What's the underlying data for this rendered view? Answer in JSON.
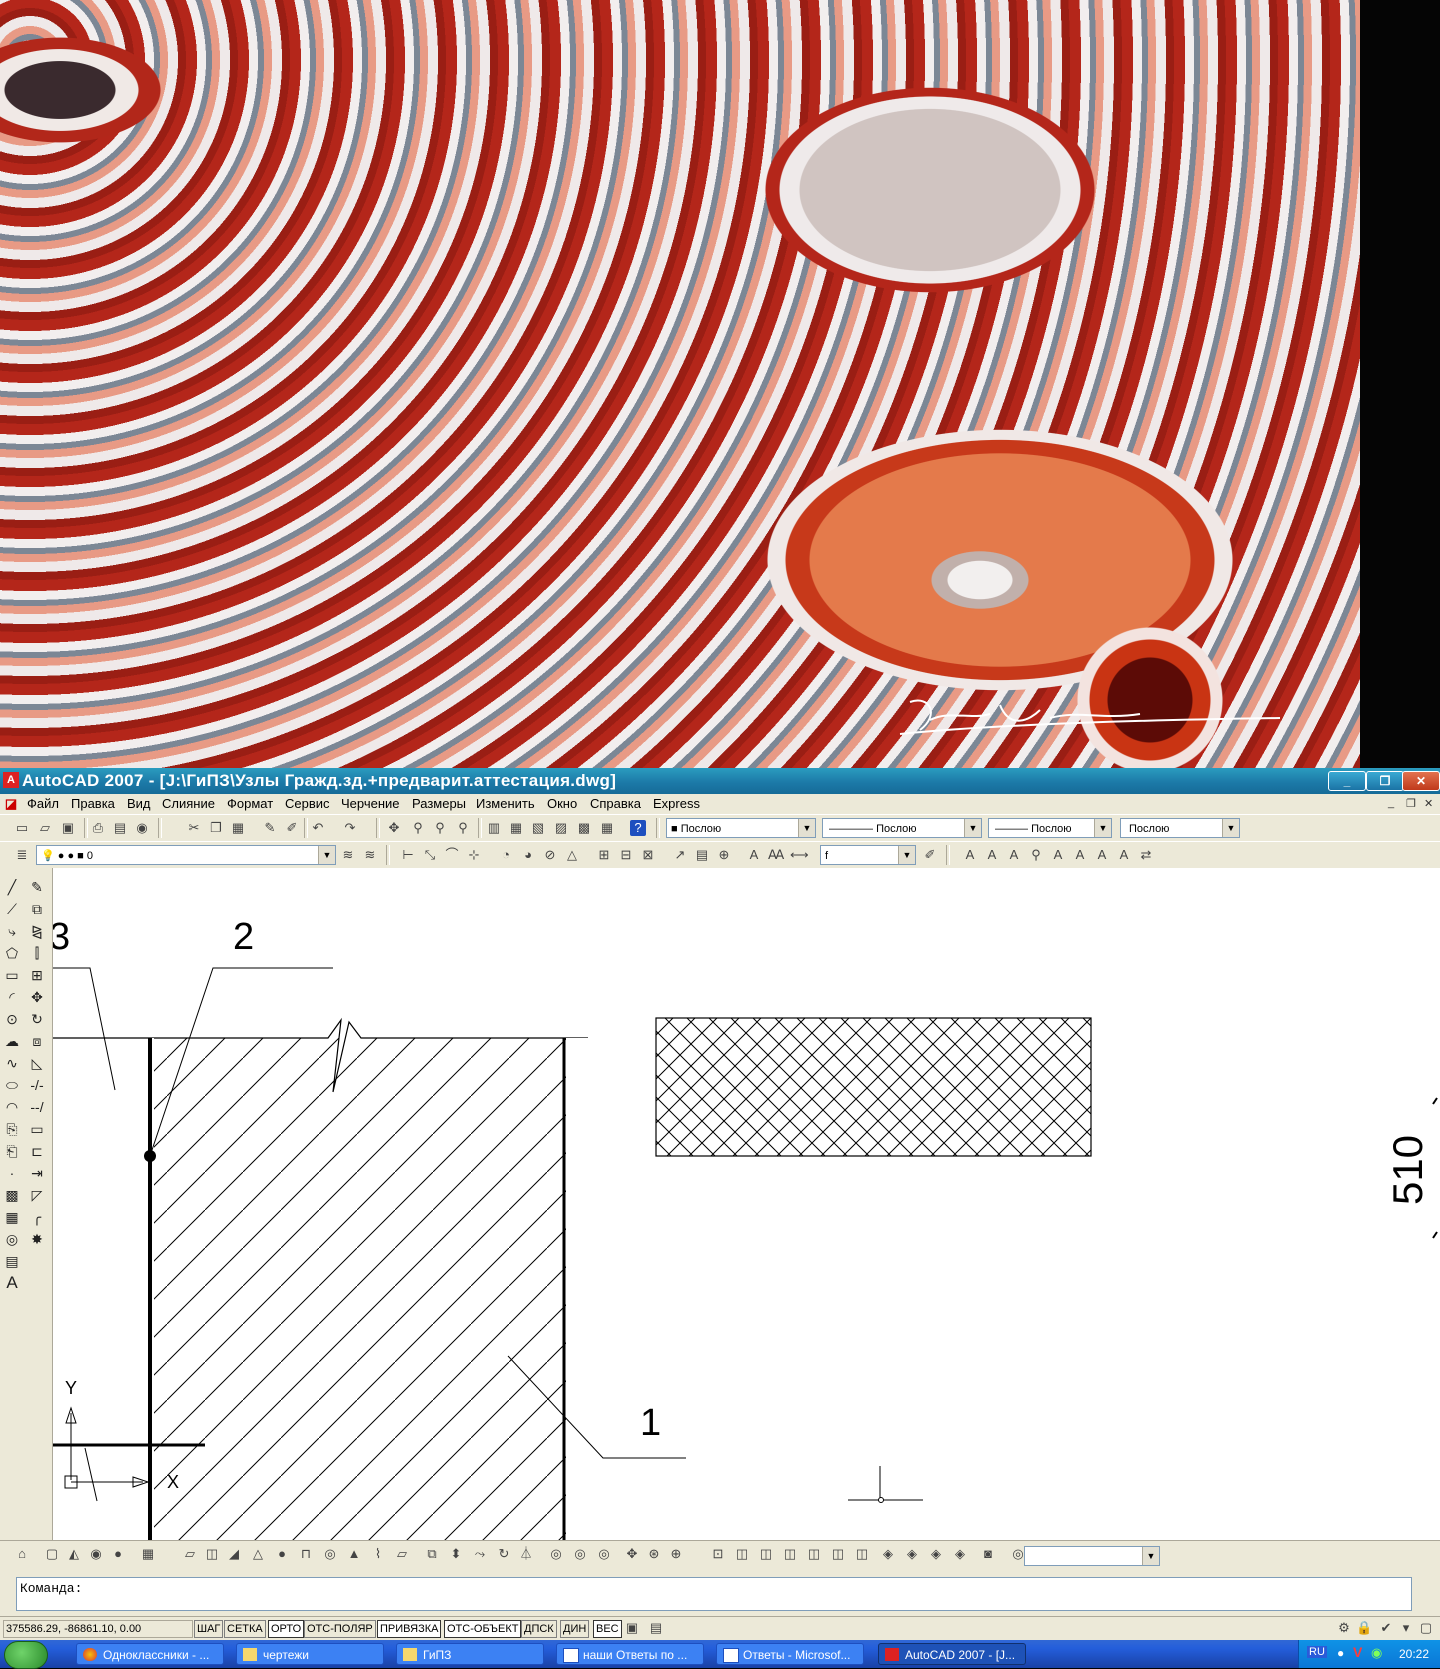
{
  "window": {
    "title": "AutoCAD 2007 - [J:\\ГиПЗ\\Узлы Гражд.зд.+предварит.аттестация.dwg]",
    "app_icon_text": "A",
    "controls": {
      "minimize": "_",
      "restore": "❐",
      "close": "✕"
    },
    "mdi_controls": {
      "minimize": "_",
      "restore": "❐",
      "close": "✕"
    }
  },
  "menu": [
    "Файл",
    "Правка",
    "Вид",
    "Слияние",
    "Формат",
    "Сервис",
    "Черчение",
    "Размеры",
    "Изменить",
    "Окно",
    "Справка",
    "Express"
  ],
  "properties": {
    "color": "Послою",
    "linetype": "Послою",
    "lineweight": "Послою",
    "plotstyle": "Послою",
    "layer": "0",
    "text_style": "f"
  },
  "drawing": {
    "label_1": "1",
    "label_2": "2",
    "label_3": "3",
    "dimension": "510",
    "ucs_y": "Y",
    "ucs_x": "X"
  },
  "command": {
    "prompt": "Команда:"
  },
  "status": {
    "coordinates": "375586.29, -86861.10, 0.00",
    "toggles": [
      "ШАГ",
      "СЕТКА",
      "ОРТО",
      "ОТС-ПОЛЯР",
      "ПРИВЯЗКА",
      "ОТС-ОБЪЕКТ",
      "ДПСК",
      "ДИН",
      "ВЕС"
    ]
  },
  "taskbar": {
    "tasks": [
      "Одноклассники - ...",
      "чертежи",
      "ГиПЗ",
      "наши Ответы по ...",
      "Ответы - Microsof...",
      "AutoCAD 2007 - [J..."
    ],
    "language": "RU",
    "clock": "20:22"
  },
  "icons": {
    "start": "windows-start-icon",
    "signature": "photographer-signature"
  }
}
